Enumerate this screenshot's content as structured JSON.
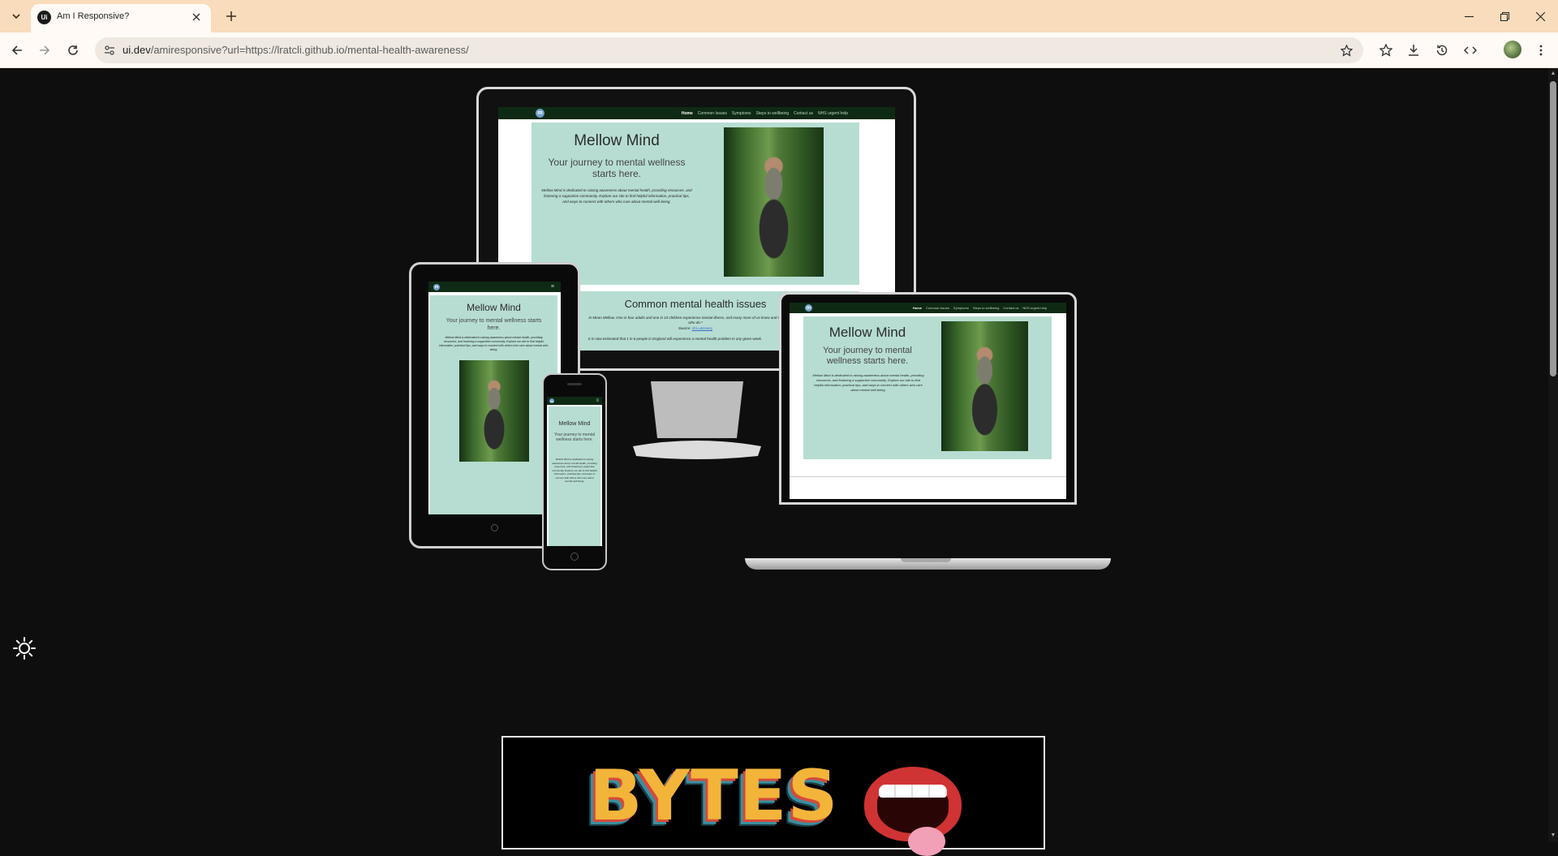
{
  "browser": {
    "tab_title": "Am I Responsive?",
    "favicon_text": "Ui",
    "url_prefix": "ui.dev",
    "url_path": "/amiresponsive?url=https://lratcli.github.io/mental-health-awareness/"
  },
  "site": {
    "name": "Mellow Mind",
    "logo_text": "m",
    "tagline": "Your journey to mental wellness starts here.",
    "intro": "Mellow Mind is dedicated to raising awareness about mental health, providing resources, and fostering a supportive community. Explore our site to find helpful information, practical tips, and ways to connect with others who care about mental well-being.",
    "nav": [
      "Home",
      "Common Issues",
      "Symptoms",
      "Steps to wellbeing",
      "Contact us",
      "NHS urgent help"
    ],
    "section_title": "Common mental health issues",
    "section_text_1": "In Mean Mellow, One in four adults and one in 10 children experience mental illness, and many more of us know and care for people who do.*",
    "section_source_label": "Source:",
    "section_source_link": "nhs.uk/every",
    "section_text_2": "It is now estimated that 1 in 6 people in England will experience a mental health problem in any given week."
  },
  "page": {
    "bytes_logo": "BYTES"
  },
  "colors": {
    "page_bg": "#0e0e0e",
    "site_nav": "#0f2a14",
    "hero_bg": "#b7ddd2",
    "tab_strip": "#f8dcbc"
  }
}
